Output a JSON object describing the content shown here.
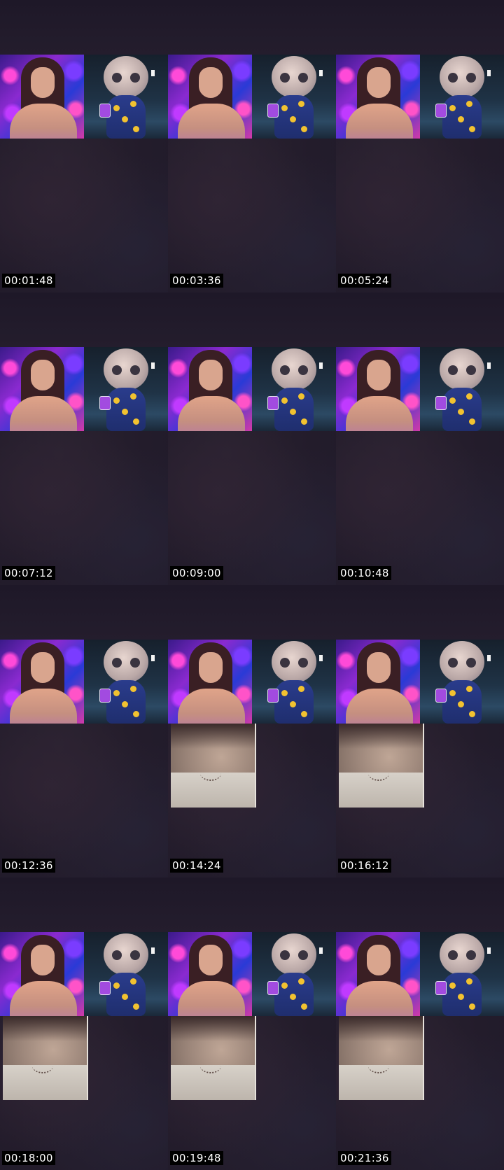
{
  "grid": {
    "columns": 3,
    "rows": 4,
    "tiles": [
      {
        "timestamp": "00:01:48",
        "has_snapshot": false
      },
      {
        "timestamp": "00:03:36",
        "has_snapshot": false
      },
      {
        "timestamp": "00:05:24",
        "has_snapshot": false
      },
      {
        "timestamp": "00:07:12",
        "has_snapshot": false
      },
      {
        "timestamp": "00:09:00",
        "has_snapshot": false
      },
      {
        "timestamp": "00:10:48",
        "has_snapshot": false
      },
      {
        "timestamp": "00:12:36",
        "has_snapshot": false
      },
      {
        "timestamp": "00:14:24",
        "has_snapshot": true
      },
      {
        "timestamp": "00:16:12",
        "has_snapshot": true
      },
      {
        "timestamp": "00:18:00",
        "has_snapshot": true
      },
      {
        "timestamp": "00:19:48",
        "has_snapshot": true
      },
      {
        "timestamp": "00:21:36",
        "has_snapshot": true
      }
    ]
  },
  "colors": {
    "background": "#221c2b",
    "timestamp_bg": "#000000",
    "timestamp_fg": "#ffffff"
  }
}
